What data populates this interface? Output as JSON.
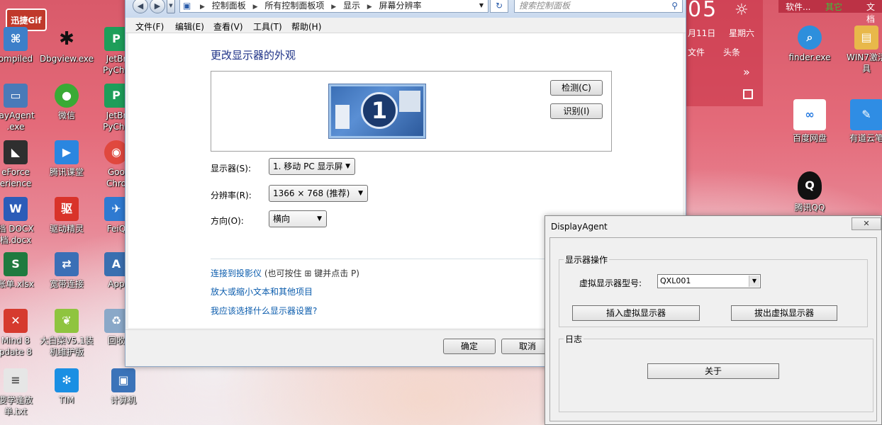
{
  "desktop": {
    "badge": "迅捷Gif",
    "icons_col1": [
      {
        "label": "ompiled",
        "label2": "",
        "icon": "app-icon",
        "color": "#3d7fc9"
      },
      {
        "label": "layAgent",
        "label2": ".exe",
        "icon": "display-agent-icon",
        "color": "#4a7ab8"
      },
      {
        "label": "eForce",
        "label2": "erience",
        "icon": "geforce-icon",
        "color": "#2f2f2f"
      },
      {
        "label": "档 DOCX",
        "label2": "档.docx",
        "icon": "word-doc-icon",
        "color": "#2b5cb8"
      },
      {
        "label": "账单.xlsx",
        "label2": "",
        "icon": "excel-icon",
        "color": "#1f7a3f"
      },
      {
        "label": "Mind 8",
        "label2": "pdate 8",
        "icon": "xmind-icon",
        "color": "#d63a2e"
      },
      {
        "label": "要学逢放",
        "label2": "单.txt",
        "icon": "text-file-icon",
        "color": "#e6e6e6"
      }
    ],
    "icons_col2": [
      {
        "label": "Dbgview.exe",
        "icon": "debug-view-icon",
        "color": "#222222"
      },
      {
        "label": "微信",
        "icon": "wechat-icon",
        "color": "#3aaa35"
      },
      {
        "label": "腾讯课堂",
        "icon": "tencent-classroom-icon",
        "color": "#2a86e0"
      },
      {
        "label": "驱动精灵",
        "icon": "driver-genius-icon",
        "color": "#d9332a"
      },
      {
        "label": "宽带连接",
        "icon": "broadband-icon",
        "color": "#3b6fb6"
      },
      {
        "label": "大白菜V5.1装",
        "label2": "机维护版",
        "icon": "cabbage-icon",
        "color": "#8fc43f"
      },
      {
        "label": "TIM",
        "icon": "tim-icon",
        "color": "#1a8fe3"
      }
    ],
    "icons_col3": [
      {
        "label": "JetBr",
        "label2": "PyCha",
        "icon": "pycharm-icon",
        "color": "#1e9e5a"
      },
      {
        "label": "JetBr",
        "label2": "PyCha",
        "icon": "pycharm-icon",
        "color": "#1e9e5a"
      },
      {
        "label": "Goo",
        "label2": "Chro",
        "icon": "chrome-icon",
        "color": "#e0483e"
      },
      {
        "label": "FeiQ",
        "icon": "feiq-icon",
        "color": "#2f7ad1"
      },
      {
        "label": "App",
        "icon": "app-store-icon",
        "color": "#3a6fb0"
      },
      {
        "label": "回收",
        "icon": "recycle-bin-icon",
        "color": "#8aa8c8"
      },
      {
        "label": "计算机",
        "icon": "computer-icon",
        "color": "#3b73b9"
      }
    ],
    "icons_right": [
      {
        "label": "finder.exe",
        "icon": "finder-icon",
        "color": "#2d8fdc"
      },
      {
        "label": "WIN7激活",
        "label2": "具",
        "icon": "folder-icon",
        "color": "#e8b84a"
      },
      {
        "label": "百度网盘",
        "icon": "baidu-netdisk-icon",
        "color": "#2a7de1"
      },
      {
        "label": "有道云笔",
        "icon": "youdao-note-icon",
        "color": "#2f8de4"
      },
      {
        "label": "腾讯QQ",
        "icon": "qq-icon",
        "color": "#111111"
      }
    ]
  },
  "widget": {
    "clock": "05",
    "date": "月11日",
    "weekday": "星期六",
    "item1": "文件",
    "item2": "头条",
    "top_labels": [
      "软件...",
      "其它",
      "文档"
    ]
  },
  "control_panel": {
    "address": [
      "控制面板",
      "所有控制面板项",
      "显示",
      "屏幕分辨率"
    ],
    "search_placeholder": "搜索控制面板",
    "menu": [
      "文件(F)",
      "编辑(E)",
      "查看(V)",
      "工具(T)",
      "帮助(H)"
    ],
    "title": "更改显示器的外观",
    "monitor_number": "1",
    "detect_button": "检测(C)",
    "identify_button": "识别(I)",
    "display_label": "显示器(S):",
    "display_value": "1. 移动 PC 显示屏",
    "resolution_label": "分辨率(R):",
    "resolution_value": "1366 × 768 (推荐)",
    "orientation_label": "方向(O):",
    "orientation_value": "横向",
    "link_projector": "连接到投影仪",
    "link_projector_tail": " (也可按住 ⊞ 键并点击 P)",
    "link_text_size": "放大或缩小文本和其他项目",
    "link_which_settings": "我应该选择什么显示器设置?",
    "ok_button": "确定",
    "cancel_button": "取消"
  },
  "display_agent": {
    "title": "DisplayAgent",
    "close_label": "✕",
    "group_ops": "显示器操作",
    "model_label": "虚拟显示器型号:",
    "model_value": "QXL001",
    "insert_button": "插入虚拟显示器",
    "remove_button": "拔出虚拟显示器",
    "group_log": "日志",
    "about_button": "关于"
  }
}
